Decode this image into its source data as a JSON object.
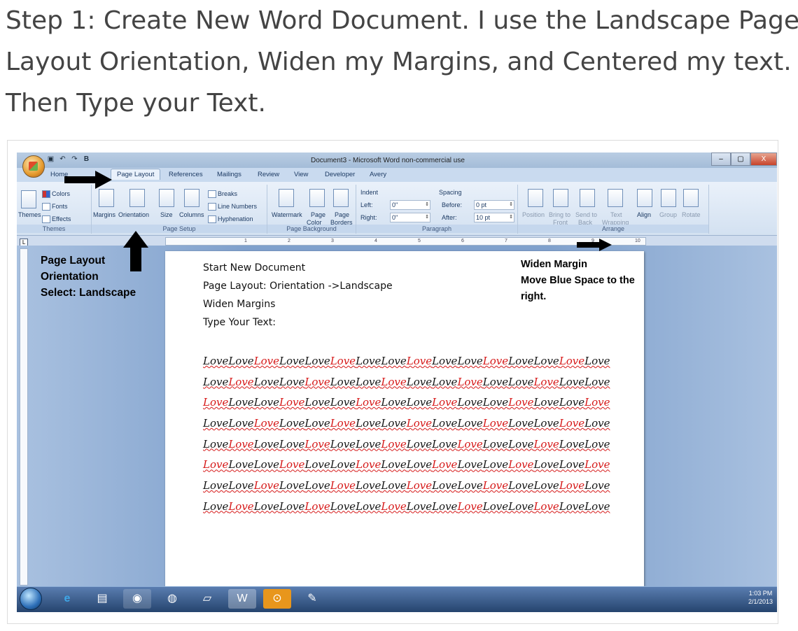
{
  "heading": {
    "line1": "Step 1: Create New Word Document. I use the Landscape Page",
    "line2": "Layout Orientation, Widen my Margins, and Centered my text.",
    "line3": "Then Type your Text."
  },
  "window": {
    "title": "Document3 - Microsoft Word non-commercial use",
    "quick_access": [
      "save-icon",
      "undo-icon",
      "redo-icon",
      "bold-icon"
    ],
    "quick_access_glyphs": [
      "▣",
      "↶",
      "↷",
      "B"
    ],
    "controls": [
      "–",
      "▢",
      "X"
    ]
  },
  "tabs": [
    "Home",
    "Page Layout",
    "References",
    "Mailings",
    "Review",
    "View",
    "Developer",
    "Avery"
  ],
  "active_tab": "Page Layout",
  "ribbon": {
    "themes": {
      "colors": "Colors",
      "fonts": "Fonts",
      "effects": "Effects",
      "themes": "Themes",
      "label": "Themes"
    },
    "page_setup": {
      "margins": "Margins",
      "orientation": "Orientation",
      "size": "Size",
      "columns": "Columns",
      "breaks": "Breaks",
      "line_numbers": "Line Numbers",
      "hyphenation": "Hyphenation",
      "label": "Page Setup"
    },
    "page_background": {
      "watermark": "Watermark",
      "page_color_1": "Page",
      "page_color_2": "Color",
      "page_borders_1": "Page",
      "page_borders_2": "Borders",
      "label": "Page Background"
    },
    "paragraph": {
      "indent": "Indent",
      "left": "Left:",
      "left_value": "0\"",
      "right": "Right:",
      "right_value": "0\"",
      "spacing": "Spacing",
      "before": "Before:",
      "before_value": "0 pt",
      "after": "After:",
      "after_value": "10 pt",
      "label": "Paragraph"
    },
    "arrange": {
      "position": "Position",
      "bring_to_front_1": "Bring to",
      "bring_to_front_2": "Front",
      "send_to_back_1": "Send to",
      "send_to_back_2": "Back",
      "text_wrapping_1": "Text",
      "text_wrapping_2": "Wrapping",
      "align": "Align",
      "group": "Group",
      "rotate": "Rotate",
      "label": "Arrange"
    }
  },
  "ruler": {
    "marks": [
      "1",
      "2",
      "3",
      "4",
      "5",
      "6",
      "7",
      "8",
      "9",
      "10"
    ],
    "corner": "L"
  },
  "document": {
    "lines": [
      "Start New Document",
      "Page Layout: Orientation ->Landscape",
      "Widen Margins",
      "Type Your Text:"
    ],
    "word": "Love",
    "rows": [
      [
        0,
        0,
        1,
        0,
        0,
        1,
        0,
        0,
        1,
        0,
        0,
        1,
        0,
        0,
        1,
        0
      ],
      [
        0,
        1,
        0,
        0,
        1,
        0,
        0,
        1,
        0,
        0,
        1,
        0,
        0,
        1,
        0,
        0
      ],
      [
        1,
        0,
        0,
        1,
        0,
        0,
        1,
        0,
        0,
        1,
        0,
        0,
        1,
        0,
        0,
        1
      ],
      [
        0,
        0,
        1,
        0,
        0,
        1,
        0,
        0,
        1,
        0,
        0,
        1,
        0,
        0,
        1,
        0
      ],
      [
        0,
        1,
        0,
        0,
        1,
        0,
        0,
        1,
        0,
        0,
        1,
        0,
        0,
        1,
        0,
        0
      ],
      [
        1,
        0,
        0,
        1,
        0,
        0,
        1,
        0,
        0,
        1,
        0,
        0,
        1,
        0,
        0,
        1
      ],
      [
        0,
        0,
        1,
        0,
        0,
        1,
        0,
        0,
        1,
        0,
        0,
        1,
        0,
        0,
        1,
        0
      ],
      [
        0,
        1,
        0,
        0,
        1,
        0,
        0,
        1,
        0,
        0,
        1,
        0,
        0,
        1,
        0,
        0
      ]
    ]
  },
  "annotations": {
    "left_1": "Page Layout",
    "left_2": "Orientation",
    "left_3": "Select: Landscape",
    "right_1": "Widen Margin",
    "right_2": "Move Blue Space to the",
    "right_3": "right."
  },
  "taskbar": {
    "apps": [
      "start-orb",
      "internet-explorer-icon",
      "file-explorer-icon",
      "firefox-icon",
      "chrome-icon",
      "sticky-notes-icon",
      "word-icon",
      "hp-icon",
      "paint-icon"
    ],
    "time": "1:03 PM",
    "date": "2/1/2013"
  }
}
